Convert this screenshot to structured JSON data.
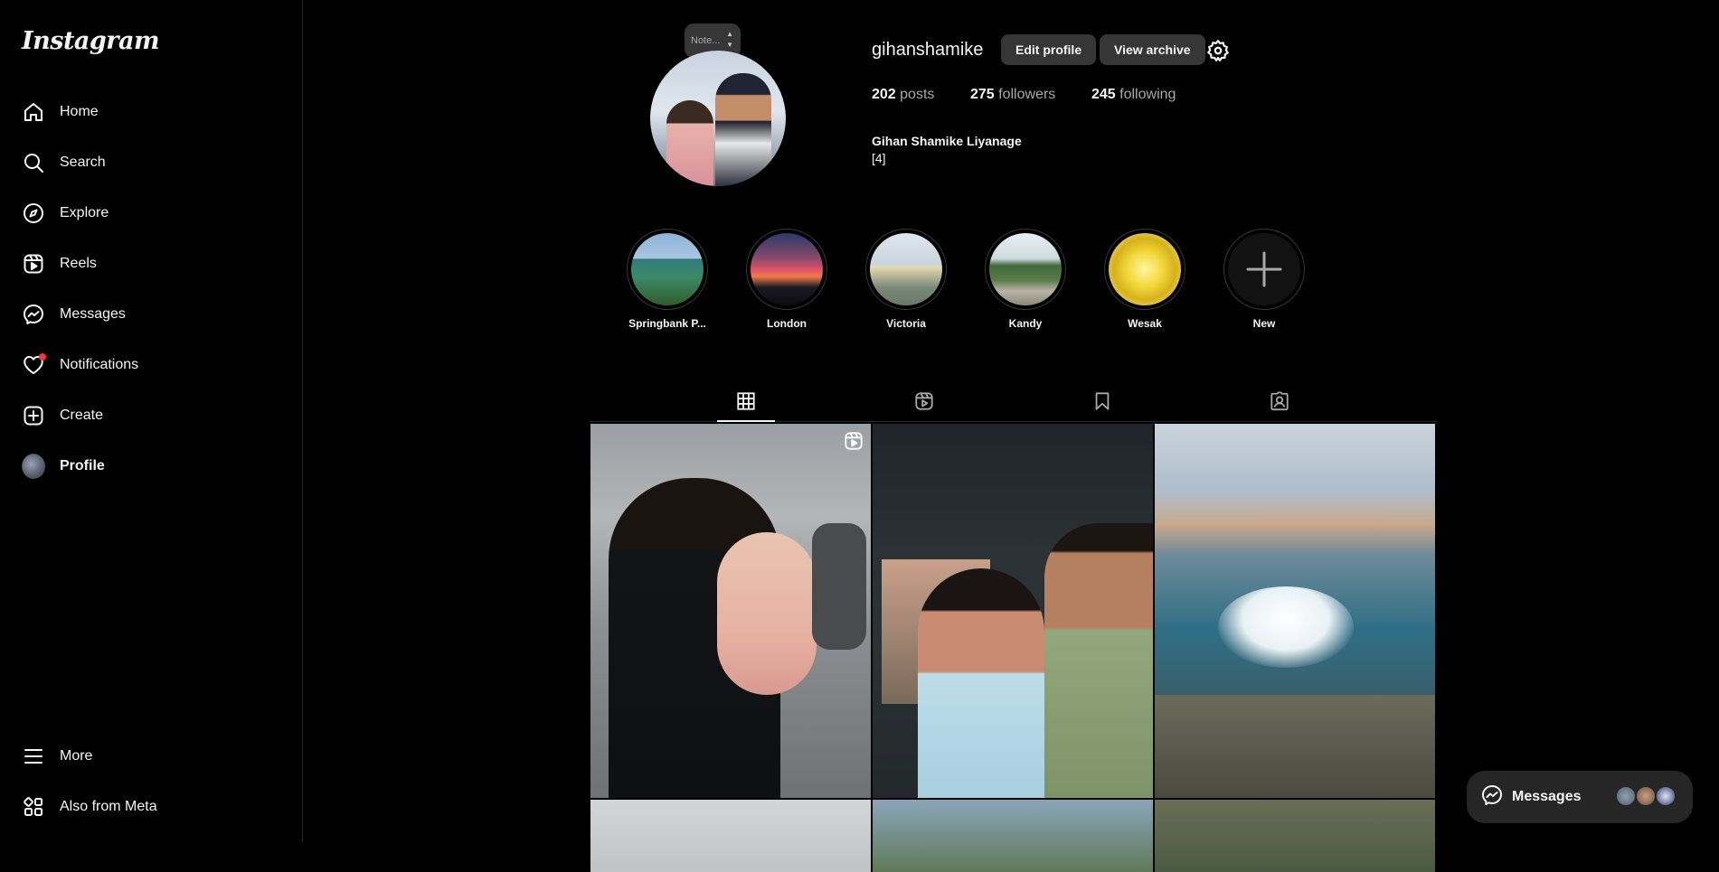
{
  "app": {
    "logo_text": "Instagram"
  },
  "sidebar": {
    "items": [
      {
        "label": "Home",
        "icon": "home-icon"
      },
      {
        "label": "Search",
        "icon": "search-icon"
      },
      {
        "label": "Explore",
        "icon": "compass-icon"
      },
      {
        "label": "Reels",
        "icon": "reels-icon"
      },
      {
        "label": "Messages",
        "icon": "messenger-icon"
      },
      {
        "label": "Notifications",
        "icon": "heart-icon",
        "has_dot": true
      },
      {
        "label": "Create",
        "icon": "plus-square-icon"
      },
      {
        "label": "Profile",
        "icon": "avatar",
        "active": true
      }
    ],
    "bottom": [
      {
        "label": "More",
        "icon": "hamburger-icon"
      },
      {
        "label": "Also from Meta",
        "icon": "meta-apps-icon"
      }
    ]
  },
  "profile": {
    "note_placeholder": "Note...",
    "username": "gihanshamike",
    "edit_profile_label": "Edit profile",
    "view_archive_label": "View archive",
    "stats": {
      "posts_count": "202",
      "posts_label": "posts",
      "followers_count": "275",
      "followers_label": "followers",
      "following_count": "245",
      "following_label": "following"
    },
    "full_name": "Gihan Shamike Liyanage",
    "bio": "[4]"
  },
  "highlights": [
    {
      "label": "Springbank P..."
    },
    {
      "label": "London"
    },
    {
      "label": "Victoria"
    },
    {
      "label": "Kandy"
    },
    {
      "label": "Wesak"
    },
    {
      "label": "New"
    }
  ],
  "tabs": [
    {
      "name": "posts",
      "icon": "grid-icon",
      "active": true
    },
    {
      "name": "reels",
      "icon": "reels-icon"
    },
    {
      "name": "saved",
      "icon": "bookmark-icon"
    },
    {
      "name": "tagged",
      "icon": "tagged-icon"
    }
  ],
  "messages_bar": {
    "label": "Messages"
  },
  "colors": {
    "background": "#000000",
    "button": "#363636",
    "notification_dot": "#ff3040",
    "secondary_text": "#a8a8a8"
  }
}
